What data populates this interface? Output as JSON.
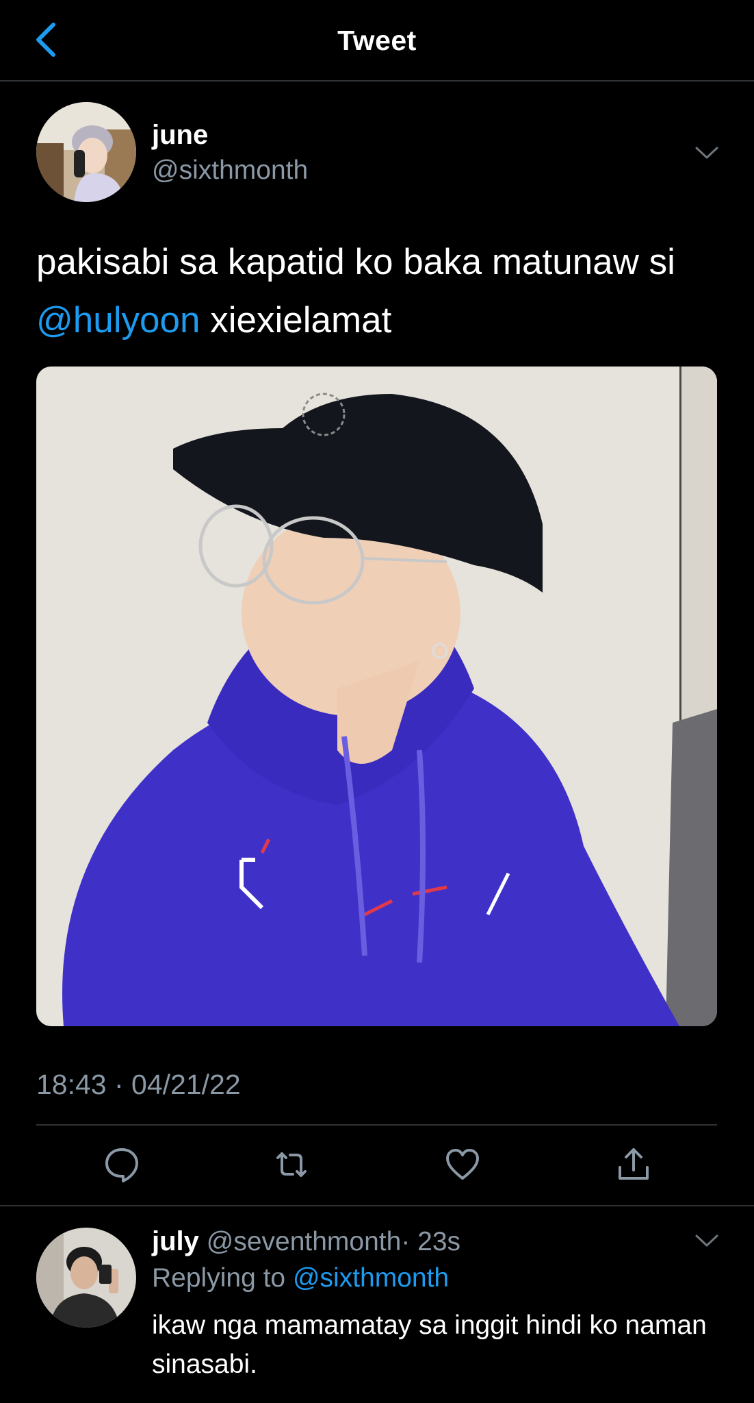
{
  "header": {
    "title": "Tweet",
    "back_icon": "chevron-left-icon"
  },
  "colors": {
    "accent": "#1d9bf0",
    "muted": "#8b98a5",
    "background": "#000000",
    "divider": "#2f3336"
  },
  "tweet": {
    "author_name": "june",
    "author_handle": "@sixthmonth",
    "text_before": "pakisabi sa kapatid ko baka matunaw si ",
    "mention": "@hulyoon",
    "text_after": " xiexielamat",
    "timestamp": "18:43 · 04/21/22",
    "actions": [
      "reply-icon",
      "retweet-icon",
      "like-icon",
      "share-icon"
    ]
  },
  "reply": {
    "author_name": "july",
    "author_handle": "@seventhmonth",
    "time": "· 23s",
    "replying_prefix": "Replying to ",
    "replying_to": "@sixthmonth",
    "text": "ikaw nga mamamatay sa inggit hindi ko naman sinasabi."
  }
}
